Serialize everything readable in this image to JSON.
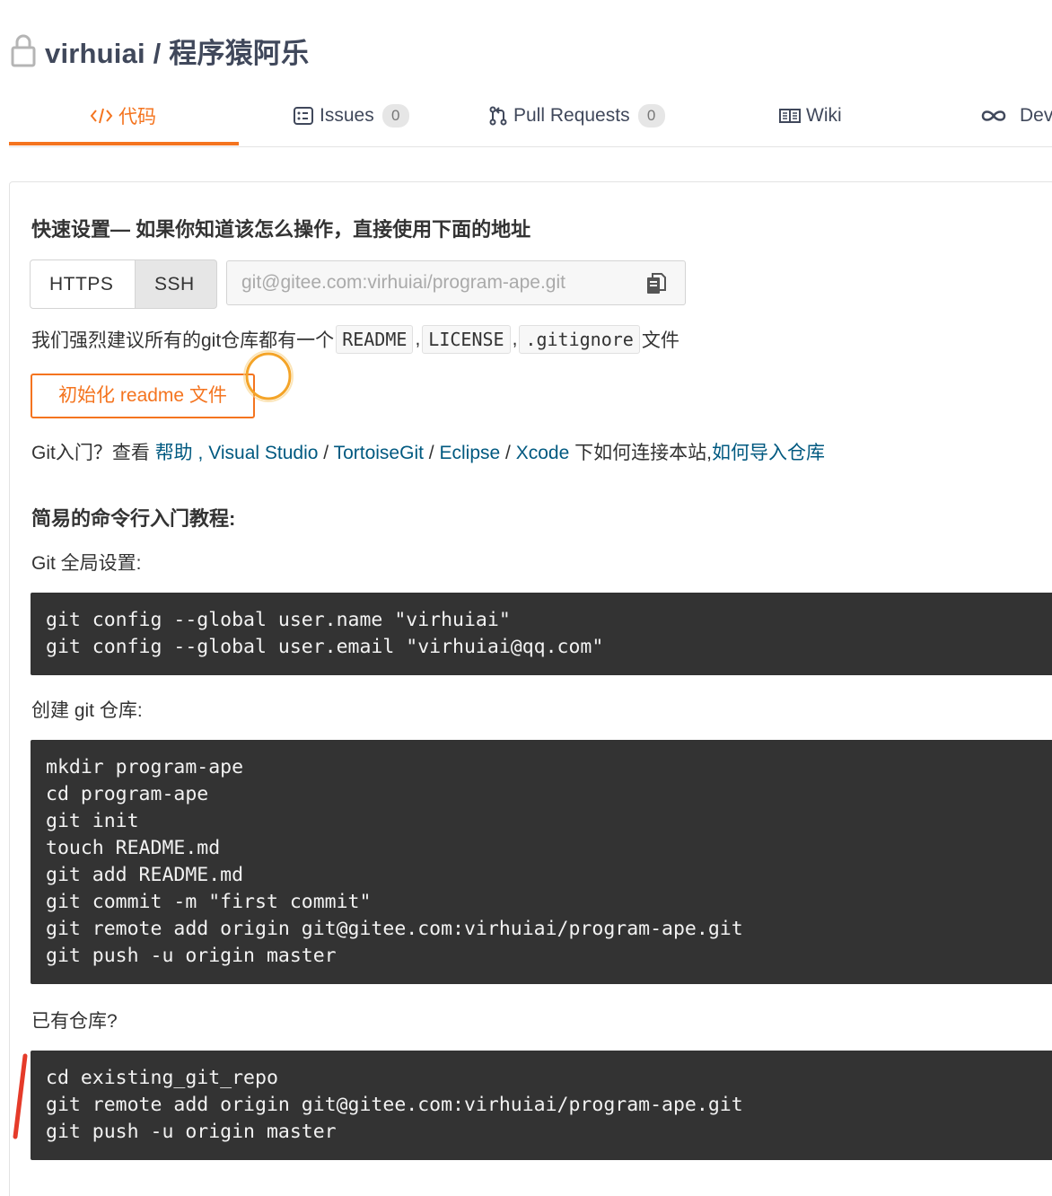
{
  "repo": {
    "title": "virhuiai / 程序猿阿乐"
  },
  "tabs": [
    {
      "label": "代码",
      "icon": "code-icon",
      "active": true
    },
    {
      "label": "Issues",
      "icon": "issues-icon",
      "count": "0"
    },
    {
      "label": "Pull Requests",
      "icon": "pull-request-icon",
      "count": "0"
    },
    {
      "label": "Wiki",
      "icon": "wiki-icon"
    },
    {
      "label": "Dev",
      "icon": "devops-icon"
    }
  ],
  "quick_setup": {
    "title": "快速设置— 如果你知道该怎么操作，直接使用下面的地址",
    "protocols": [
      "HTTPS",
      "SSH"
    ],
    "url_placeholder": "git@gitee.com:virhuiai/program-ape.git",
    "recommend_prefix": "我们强烈建议所有的git仓库都有一个",
    "files": [
      "README",
      "LICENSE",
      ".gitignore"
    ],
    "separator": ",",
    "recommend_suffix": "文件",
    "init_button": "初始化 readme 文件"
  },
  "help": {
    "prefix": "Git入门？查看",
    "links": [
      "帮助",
      "Visual Studio",
      "TortoiseGit",
      "Eclipse",
      "Xcode"
    ],
    "link_sep_comma": ",",
    "link_sep_slash": "/",
    "middle": "下如何连接本站,",
    "import_link": "如何导入仓库"
  },
  "tutorial": {
    "heading": "简易的命令行入门教程:",
    "global_label": "Git 全局设置:",
    "global_code": [
      "git config --global user.name \"virhuiai\"",
      "git config --global user.email \"virhuiai@qq.com\""
    ],
    "create_label": "创建 git 仓库:",
    "create_code": [
      "mkdir program-ape",
      "cd program-ape",
      "git init",
      "touch README.md",
      "git add README.md",
      "git commit -m \"first commit\"",
      "git remote add origin git@gitee.com:virhuiai/program-ape.git",
      "git push -u origin master"
    ],
    "existing_label": "已有仓库?",
    "existing_code": [
      "cd existing_git_repo",
      "git remote add origin git@gitee.com:virhuiai/program-ape.git",
      "git push -u origin master"
    ]
  },
  "colors": {
    "accent": "#f4741f",
    "link": "#005980",
    "code_bg": "#333333",
    "annotation": "#e53b2a"
  }
}
